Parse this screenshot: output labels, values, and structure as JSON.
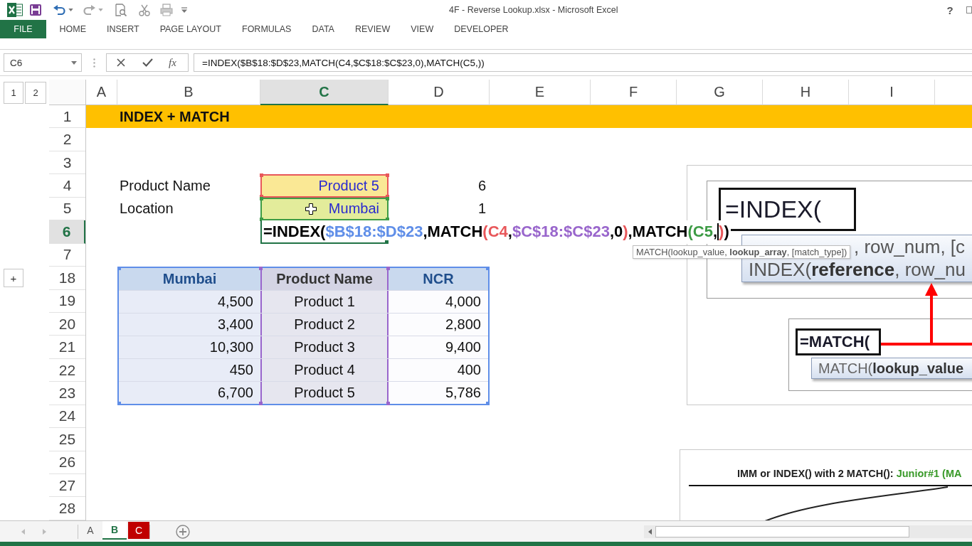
{
  "window": {
    "title": "4F - Reverse Lookup.xlsx - Microsoft Excel",
    "help": "?"
  },
  "ribbon_tabs": [
    {
      "label": "FILE",
      "kind": "backstage"
    },
    {
      "label": "HOME",
      "kind": "tab"
    },
    {
      "label": "INSERT",
      "kind": "tab"
    },
    {
      "label": "PAGE LAYOUT",
      "kind": "tab"
    },
    {
      "label": "FORMULAS",
      "kind": "tab"
    },
    {
      "label": "DATA",
      "kind": "tab"
    },
    {
      "label": "REVIEW",
      "kind": "tab"
    },
    {
      "label": "VIEW",
      "kind": "tab"
    },
    {
      "label": "DEVELOPER",
      "kind": "tab"
    }
  ],
  "formula_bar": {
    "name_box": "C6",
    "function_label": "fx",
    "formula": "=INDEX($B$18:$D$23,MATCH(C4,$C$18:$C$23,0),MATCH(C5,))"
  },
  "outline_levels": [
    "1",
    "2"
  ],
  "columns": [
    {
      "label": "A",
      "selected": false
    },
    {
      "label": "B",
      "selected": false
    },
    {
      "label": "C",
      "selected": true
    },
    {
      "label": "D",
      "selected": false
    },
    {
      "label": "E",
      "selected": false
    },
    {
      "label": "F",
      "selected": false
    },
    {
      "label": "G",
      "selected": false
    },
    {
      "label": "H",
      "selected": false
    },
    {
      "label": "I",
      "selected": false
    }
  ],
  "rows": [
    {
      "label": "1",
      "selected": false
    },
    {
      "label": "2",
      "selected": false
    },
    {
      "label": "3",
      "selected": false
    },
    {
      "label": "4",
      "selected": false
    },
    {
      "label": "5",
      "selected": false
    },
    {
      "label": "6",
      "selected": true
    },
    {
      "label": "7",
      "selected": false
    },
    {
      "label": "18",
      "selected": false,
      "group_toggle": "+"
    },
    {
      "label": "19",
      "selected": false
    },
    {
      "label": "20",
      "selected": false
    },
    {
      "label": "21",
      "selected": false
    },
    {
      "label": "22",
      "selected": false
    },
    {
      "label": "23",
      "selected": false
    },
    {
      "label": "24",
      "selected": false
    },
    {
      "label": "25",
      "selected": false
    },
    {
      "label": "26",
      "selected": false
    },
    {
      "label": "27",
      "selected": false
    },
    {
      "label": "28",
      "selected": false
    }
  ],
  "banner": {
    "text": "INDEX + MATCH"
  },
  "inputs": [
    {
      "label": "Product Name",
      "value": "Product 5",
      "result": "6",
      "color": "#e8575a",
      "fill": {
        "color": "#fae895"
      }
    },
    {
      "label": "Location",
      "value": "Mumbai",
      "result": "1",
      "color": "#3d9b45",
      "fill": {
        "color": "#e3ec9b"
      }
    }
  ],
  "edit_cell": {
    "segments": [
      {
        "kind": "text",
        "text": "=INDEX(",
        "color": "#000000"
      },
      {
        "kind": "text",
        "text": "$B$18:$D$23",
        "color": "#5f8ee8"
      },
      {
        "kind": "text",
        "text": ",MATCH",
        "color": "#000000"
      },
      {
        "kind": "text",
        "text": "(C4",
        "color": "#e8575a"
      },
      {
        "kind": "text",
        "text": ",",
        "color": "#000000"
      },
      {
        "kind": "text",
        "text": "$C$18:$C$23",
        "color": "#9966cc"
      },
      {
        "kind": "text",
        "text": ",0",
        "color": "#000000"
      },
      {
        "kind": "text",
        "text": ")",
        "color": "#e8575a"
      },
      {
        "kind": "text",
        "text": ",MATCH",
        "color": "#000000"
      },
      {
        "kind": "text",
        "text": "(C5",
        "color": "#3d9b45"
      },
      {
        "kind": "text",
        "text": ",",
        "color": "#000000"
      },
      {
        "kind": "caret"
      },
      {
        "kind": "text",
        "text": ")",
        "color": "#e8575a"
      },
      {
        "kind": "text",
        "text": ")",
        "color": "#000000"
      }
    ],
    "tooltip": "MATCH(lookup_value, **lookup_array**, [match_type])"
  },
  "table": {
    "ranges": [
      {
        "kind": "table",
        "color": "#5f8ee8"
      },
      {
        "kind": "column",
        "color": "#9966cc"
      }
    ],
    "header": [
      "Mumbai",
      "Product Name",
      "NCR"
    ],
    "rows": [
      [
        "4,500",
        "Product 1",
        "4,000"
      ],
      [
        "3,400",
        "Product 2",
        "2,800"
      ],
      [
        "10,300",
        "Product 3",
        "9,400"
      ],
      [
        "450",
        "Product 4",
        "400"
      ],
      [
        "6,700",
        "Product 5",
        "5,786"
      ]
    ]
  },
  "picture_index": {
    "formula": "=INDEX(",
    "hint_line_1": ", row_num, [c",
    "hint_line_2": "INDEX(**reference**, row_nu",
    "match_formula": "=MATCH(",
    "match_hint": "MATCH(**lookup_value**"
  },
  "picture_heading": {
    "text": "IMM or INDEX() with 2 MATCH():",
    "highlight": "Junior#1 (MA"
  },
  "sheet_tabs": [
    {
      "label": "A",
      "selected": false
    },
    {
      "label": "B",
      "selected": true
    },
    {
      "label": "C",
      "selected": false,
      "color": "#c00000"
    }
  ]
}
